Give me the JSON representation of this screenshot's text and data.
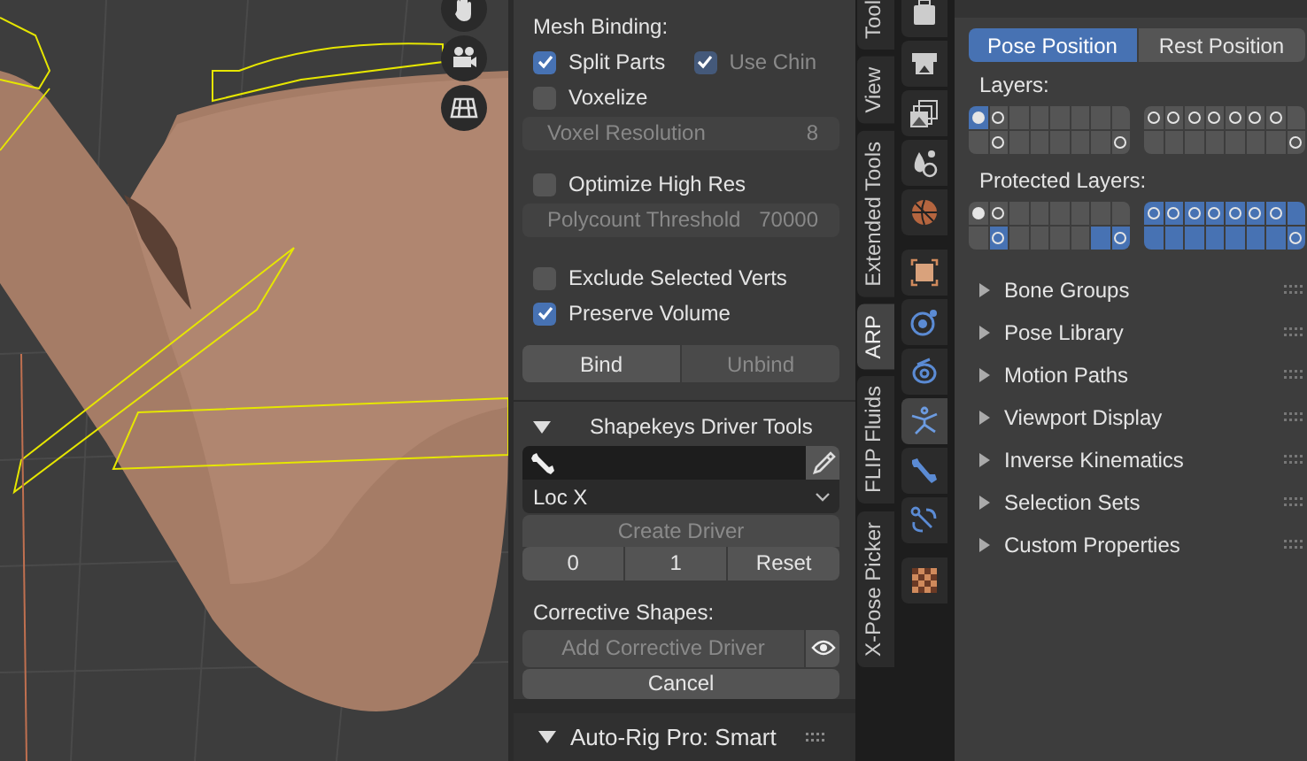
{
  "viewport": {
    "tools": [
      {
        "kind": "hand"
      },
      {
        "kind": "camera"
      },
      {
        "kind": "grid"
      }
    ]
  },
  "sidebar": {
    "heading": "Mesh Binding:",
    "split_parts": {
      "label": "Split Parts",
      "checked": true,
      "disabled": false
    },
    "use_chin": {
      "label": "Use Chin",
      "checked": true,
      "disabled": true
    },
    "voxelize": {
      "label": "Voxelize",
      "checked": false,
      "disabled": false
    },
    "voxel_resolution": {
      "label": "Voxel Resolution",
      "value": "8",
      "disabled": true
    },
    "optimize": {
      "label": "Optimize High Res",
      "checked": false,
      "disabled": false
    },
    "polycount": {
      "label": "Polycount Threshold",
      "value": "70000",
      "disabled": true
    },
    "exclude": {
      "label": "Exclude Selected Verts",
      "checked": false,
      "disabled": false
    },
    "preserve": {
      "label": "Preserve Volume",
      "checked": true,
      "disabled": false
    },
    "bind_buttons": [
      {
        "label": "Bind",
        "disabled": false
      },
      {
        "label": "Unbind",
        "disabled": true
      }
    ],
    "shapekeys": {
      "title": "Shapekeys Driver Tools",
      "expanded": true,
      "transform": "Loc X",
      "create_driver": {
        "label": "Create Driver",
        "disabled": true
      },
      "value_buttons": [
        {
          "label": "0"
        },
        {
          "label": "1"
        },
        {
          "label": "Reset"
        }
      ],
      "corrective_heading": "Corrective Shapes:",
      "add_corrective": {
        "label": "Add Corrective Driver",
        "disabled": true
      },
      "cancel": {
        "label": "Cancel",
        "disabled": false
      }
    },
    "bottom_panel": {
      "title": "Auto-Rig Pro: Smart",
      "expanded": true
    }
  },
  "vertical_tabs": [
    {
      "label": "Tool",
      "selected": false
    },
    {
      "label": "View",
      "selected": false
    },
    {
      "label": "Extended Tools",
      "selected": false
    },
    {
      "label": "ARP",
      "selected": true
    },
    {
      "label": "FLIP Fluids",
      "selected": false
    },
    {
      "label": "X-Pose Picker",
      "selected": false
    }
  ],
  "property_tab_groups": [
    [
      {
        "kind": "tool",
        "selected": false
      },
      {
        "kind": "printer",
        "selected": false
      },
      {
        "kind": "image",
        "selected": false
      },
      {
        "kind": "droplets",
        "selected": false
      },
      {
        "kind": "globe",
        "selected": false
      }
    ],
    [
      {
        "kind": "square",
        "selected": false
      },
      {
        "kind": "orbit",
        "selected": false
      },
      {
        "kind": "ring",
        "selected": false
      },
      {
        "kind": "figure",
        "selected": true
      },
      {
        "kind": "bone",
        "selected": false
      },
      {
        "kind": "bone-link",
        "selected": false
      }
    ],
    [
      {
        "kind": "checker",
        "selected": false
      }
    ]
  ],
  "properties": {
    "pose_buttons": [
      {
        "label": "Pose Position",
        "selected": true
      },
      {
        "label": "Rest Position",
        "selected": false
      }
    ],
    "layer_sets": [
      {
        "label": "Layers:",
        "blocks": [
          {
            "rows": [
              [
                {
                  "kind": "dot",
                  "selected": true
                },
                {
                  "kind": "ring",
                  "selected": false
                },
                {
                  "kind": "empty",
                  "selected": false
                },
                {
                  "kind": "empty",
                  "selected": false
                },
                {
                  "kind": "empty",
                  "selected": false
                },
                {
                  "kind": "empty",
                  "selected": false
                },
                {
                  "kind": "empty",
                  "selected": false
                },
                {
                  "kind": "empty",
                  "selected": false
                }
              ],
              [
                {
                  "kind": "empty",
                  "selected": false
                },
                {
                  "kind": "ring",
                  "selected": false
                },
                {
                  "kind": "empty",
                  "selected": false
                },
                {
                  "kind": "empty",
                  "selected": false
                },
                {
                  "kind": "empty",
                  "selected": false
                },
                {
                  "kind": "empty",
                  "selected": false
                },
                {
                  "kind": "empty",
                  "selected": false
                },
                {
                  "kind": "ring",
                  "selected": false
                }
              ]
            ]
          },
          {
            "rows": [
              [
                {
                  "kind": "ring",
                  "selected": false
                },
                {
                  "kind": "ring",
                  "selected": false
                },
                {
                  "kind": "ring",
                  "selected": false
                },
                {
                  "kind": "ring",
                  "selected": false
                },
                {
                  "kind": "ring",
                  "selected": false
                },
                {
                  "kind": "ring",
                  "selected": false
                },
                {
                  "kind": "ring",
                  "selected": false
                },
                {
                  "kind": "empty",
                  "selected": false
                }
              ],
              [
                {
                  "kind": "empty",
                  "selected": false
                },
                {
                  "kind": "empty",
                  "selected": false
                },
                {
                  "kind": "empty",
                  "selected": false
                },
                {
                  "kind": "empty",
                  "selected": false
                },
                {
                  "kind": "empty",
                  "selected": false
                },
                {
                  "kind": "empty",
                  "selected": false
                },
                {
                  "kind": "empty",
                  "selected": false
                },
                {
                  "kind": "ring",
                  "selected": false
                }
              ]
            ]
          }
        ]
      },
      {
        "label": "Protected Layers:",
        "blocks": [
          {
            "rows": [
              [
                {
                  "kind": "dot",
                  "selected": false
                },
                {
                  "kind": "ring",
                  "selected": false
                },
                {
                  "kind": "empty",
                  "selected": false
                },
                {
                  "kind": "empty",
                  "selected": false
                },
                {
                  "kind": "empty",
                  "selected": false
                },
                {
                  "kind": "empty",
                  "selected": false
                },
                {
                  "kind": "empty",
                  "selected": false
                },
                {
                  "kind": "empty",
                  "selected": false
                }
              ],
              [
                {
                  "kind": "empty",
                  "selected": false
                },
                {
                  "kind": "ring",
                  "selected": true
                },
                {
                  "kind": "empty",
                  "selected": false
                },
                {
                  "kind": "empty",
                  "selected": false
                },
                {
                  "kind": "empty",
                  "selected": false
                },
                {
                  "kind": "empty",
                  "selected": false
                },
                {
                  "kind": "empty",
                  "selected": true
                },
                {
                  "kind": "ring",
                  "selected": true
                }
              ]
            ]
          },
          {
            "rows": [
              [
                {
                  "kind": "ring",
                  "selected": true
                },
                {
                  "kind": "ring",
                  "selected": true
                },
                {
                  "kind": "ring",
                  "selected": true
                },
                {
                  "kind": "ring",
                  "selected": true
                },
                {
                  "kind": "ring",
                  "selected": true
                },
                {
                  "kind": "ring",
                  "selected": true
                },
                {
                  "kind": "ring",
                  "selected": true
                },
                {
                  "kind": "empty",
                  "selected": true
                }
              ],
              [
                {
                  "kind": "empty",
                  "selected": true
                },
                {
                  "kind": "empty",
                  "selected": true
                },
                {
                  "kind": "empty",
                  "selected": true
                },
                {
                  "kind": "empty",
                  "selected": true
                },
                {
                  "kind": "empty",
                  "selected": true
                },
                {
                  "kind": "empty",
                  "selected": true
                },
                {
                  "kind": "empty",
                  "selected": true
                },
                {
                  "kind": "ring",
                  "selected": true
                }
              ]
            ]
          }
        ]
      }
    ],
    "panels": [
      {
        "title": "Bone Groups",
        "expanded": false
      },
      {
        "title": "Pose Library",
        "expanded": false
      },
      {
        "title": "Motion Paths",
        "expanded": false
      },
      {
        "title": "Viewport Display",
        "expanded": false
      },
      {
        "title": "Inverse Kinematics",
        "expanded": false
      },
      {
        "title": "Selection Sets",
        "expanded": false
      },
      {
        "title": "Custom Properties",
        "expanded": false
      }
    ]
  }
}
